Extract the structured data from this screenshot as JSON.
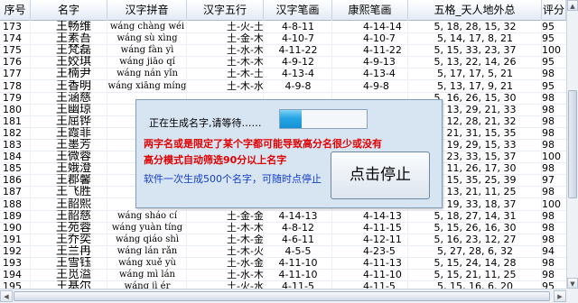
{
  "columns": [
    "序号",
    "名字",
    "汉字拼音",
    "汉字五行",
    "汉字笔画",
    "康熙笔画",
    "五格_天人地外总",
    "评分"
  ],
  "rows": [
    {
      "no": "173",
      "name": "王畅维",
      "pinyin": "wáng chàng wéi",
      "wuxing": "土-火-土",
      "bihua": "4-8-11",
      "kangxi": "4-14-14",
      "wuge": "5, 18, 28, 15, 32",
      "score": "95"
    },
    {
      "no": "174",
      "name": "王素吾",
      "pinyin": "wáng sù xìng",
      "wuxing": "土-金-木",
      "bihua": "4-10-7",
      "kangxi": "4-10-7",
      "wuge": "5, 14, 17, 8, 21",
      "score": "95"
    },
    {
      "no": "175",
      "name": "王梵磊",
      "pinyin": "wáng fàn yì",
      "wuxing": "土-水-木",
      "bihua": "4-11-22",
      "kangxi": "4-11-22",
      "wuge": "5, 15, 33, 23, 37",
      "score": "100"
    },
    {
      "no": "176",
      "name": "王姣琪",
      "pinyin": "wáng jiāo qí",
      "wuxing": "土-木-木",
      "bihua": "4-9-12",
      "kangxi": "4-9-13",
      "wuge": "5, 13, 22, 14, 26",
      "score": "95"
    },
    {
      "no": "177",
      "name": "王楠尹",
      "pinyin": "wáng nán yǐn",
      "wuxing": "土-木-土",
      "bihua": "4-13-4",
      "kangxi": "4-13-4",
      "wuge": "5, 17, 17, 5, 21",
      "score": "98"
    },
    {
      "no": "178",
      "name": "王香明",
      "pinyin": "wáng xiāng míng",
      "wuxing": "土-木-水",
      "bihua": "4-9-8",
      "kangxi": "4-9-8",
      "wuge": "5, 13, 17, 9, 21",
      "score": "95"
    },
    {
      "no": "179",
      "name": "王涵慈",
      "pinyin": "",
      "wuxing": "",
      "bihua": "",
      "kangxi": "",
      "wuge": "5, 16, 26, 15, 30",
      "score": "98"
    },
    {
      "no": "180",
      "name": "王幽琼",
      "pinyin": "",
      "wuxing": "",
      "bihua": "",
      "kangxi": "",
      "wuge": "5, 13, 29, 21, 33",
      "score": "98"
    },
    {
      "no": "181",
      "name": "王屈铧",
      "pinyin": "",
      "wuxing": "",
      "bihua": "",
      "kangxi": "",
      "wuge": "5, 12, 28, 21, 32",
      "score": "98"
    },
    {
      "no": "182",
      "name": "王霞菲",
      "pinyin": "",
      "wuxing": "",
      "bihua": "",
      "kangxi": "",
      "wuge": "5, 21, 31, 15, 35",
      "score": "98"
    },
    {
      "no": "183",
      "name": "王墨芳",
      "pinyin": "",
      "wuxing": "",
      "bihua": "",
      "kangxi": "",
      "wuge": "5, 19, 29, 15, 33",
      "score": "98"
    },
    {
      "no": "184",
      "name": "王微蓉",
      "pinyin": "",
      "wuxing": "",
      "bihua": "",
      "kangxi": "",
      "wuge": "5, 23, 33, 15, 37",
      "score": "100"
    },
    {
      "no": "185",
      "name": "王娥澄",
      "pinyin": "",
      "wuxing": "",
      "bihua": "",
      "kangxi": "",
      "wuge": "5, 11, 26, 17, 30",
      "score": "98"
    },
    {
      "no": "186",
      "name": "王郡馨",
      "pinyin": "",
      "wuxing": "",
      "bihua": "",
      "kangxi": "",
      "wuge": "5, 15, 35, 25, 39",
      "score": "97"
    },
    {
      "no": "187",
      "name": "王飞胜",
      "pinyin": "",
      "wuxing": "",
      "bihua": "",
      "kangxi": "",
      "wuge": "5, 13, 21, 11, 25",
      "score": "98"
    },
    {
      "no": "188",
      "name": "王韶熙",
      "pinyin": "",
      "wuxing": "",
      "bihua": "",
      "kangxi": "",
      "wuge": "5, 19, 33, 18, 37",
      "score": "100"
    },
    {
      "no": "189",
      "name": "王韶慈",
      "pinyin": "wáng sháo cí",
      "wuxing": "土-金-金",
      "bihua": "4-14-13",
      "kangxi": "4-14-13",
      "wuge": "5, 18, 27, 14, 31",
      "score": "98"
    },
    {
      "no": "190",
      "name": "王苑蓉",
      "pinyin": "wáng yuàn tíng",
      "wuxing": "土-木-木",
      "bihua": "4-8-12",
      "kangxi": "4-11-15",
      "wuge": "5, 15, 26, 16, 30",
      "score": "98"
    },
    {
      "no": "191",
      "name": "王乔奕",
      "pinyin": "wáng qiáo shì",
      "wuxing": "土-木-金",
      "bihua": "4-6-11",
      "kangxi": "4-12-11",
      "wuge": "5, 16, 23, 12, 27",
      "score": "98"
    },
    {
      "no": "192",
      "name": "王兰冉",
      "pinyin": "wáng lán rǎn",
      "wuxing": "土-木-火",
      "bihua": "4-5-5",
      "kangxi": "4-23-5",
      "wuge": "5, 27, 28, 6, 32",
      "score": "94"
    },
    {
      "no": "193",
      "name": "王雪钰",
      "pinyin": "wáng xuě yù",
      "wuxing": "土-水-金",
      "bihua": "4-11-10",
      "kangxi": "4-11-13",
      "wuge": "5, 15, 24, 14, 28",
      "score": "98"
    },
    {
      "no": "194",
      "name": "王觅溢",
      "pinyin": "wáng mì lán",
      "wuxing": "土-水-木",
      "bihua": "4-11-10",
      "kangxi": "4-11-10",
      "wuge": "5, 15, 21, 11, 25",
      "score": "98"
    },
    {
      "no": "195",
      "name": "王基尔",
      "pinyin": "wáng jì ér",
      "wuxing": "土-火-水",
      "bihua": "4-11-5",
      "kangxi": "4-11-5",
      "wuge": "5, 15, 16, 6, 20",
      "score": "95"
    }
  ],
  "dialog": {
    "status_text": "正在生成名字,请等待……",
    "progress": 0.25,
    "warning_line1": "两字名或是限定了某个字都可能导致高分名很少或没有",
    "warning_line2": "高分模式自动筛选90分以上名字",
    "tip": "软件一次生成500个名字，可随时点停止",
    "stop_button": "点击停止"
  },
  "colors": {
    "warning": "#e00000",
    "tip": "#1540c8",
    "progress_fill": "#26a5e4",
    "dialog_bg": "#d7e4f2"
  },
  "icons": {
    "scroll_up": "▲",
    "scroll_down": "▼",
    "scroll_left": "◀",
    "scroll_right": "▶"
  }
}
